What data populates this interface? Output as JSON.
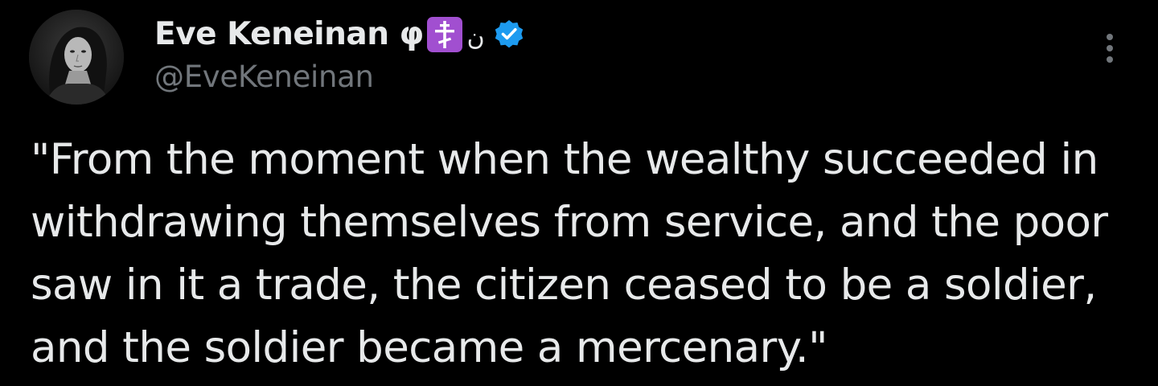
{
  "author": {
    "display_name": "Eve Keneinan φ",
    "arabic_suffix": "ن",
    "handle": "@EveKeneinan",
    "icons": {
      "orthodox_cross": "orthodox-cross-icon",
      "verified": "verified-badge-icon",
      "avatar": "profile-photo"
    },
    "colors": {
      "badge_purple": "#a14fd0",
      "verified_blue": "#1d9bf0"
    }
  },
  "tweet": {
    "text": "\"From the moment when the wealthy succeeded in withdrawing themselves from service, and the poor saw in it a trade, the citizen ceased to be a soldier, and the soldier became a mercenary.\""
  },
  "actions": {
    "more_icon": "more-options-icon"
  },
  "theme": {
    "background": "#000000",
    "primary_text": "#e7e9ea",
    "secondary_text": "#71767b"
  }
}
